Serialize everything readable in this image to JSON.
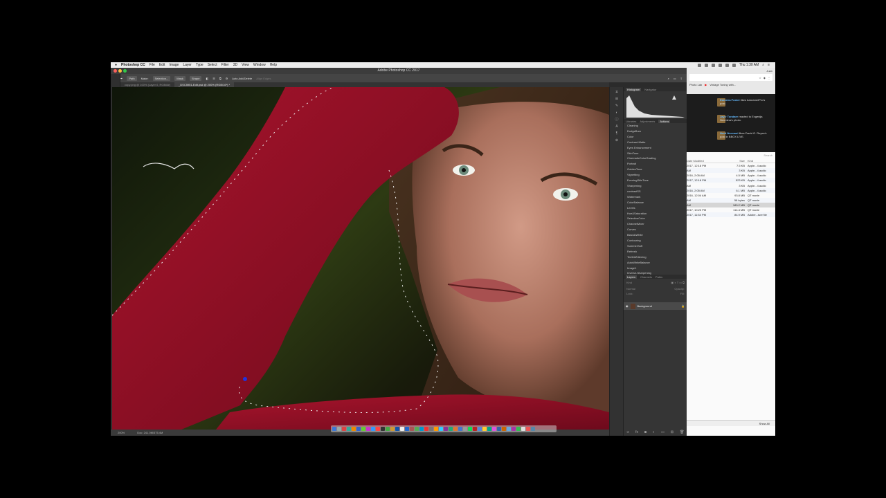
{
  "menubar": {
    "apple": "",
    "app": "Photoshop CC",
    "items": [
      "File",
      "Edit",
      "Image",
      "Layer",
      "Type",
      "Select",
      "Filter",
      "3D",
      "View",
      "Window",
      "Help"
    ],
    "clock": "Thu 1:30 AM"
  },
  "window": {
    "title": "Adobe Photoshop CC 2017"
  },
  "options": {
    "mode": "Path",
    "make": "Make:",
    "selection": "Selection...",
    "mask": "Mask",
    "shape": "Shape",
    "auto": "Auto Add/Delete",
    "align": "Align Edges"
  },
  "tabs": [
    "copy.png @ 100% (Layer 0, RGB/8#)",
    "_DSC5951-Edit.psd @ 200% (RGB/16*) *"
  ],
  "status": {
    "zoom": "200%",
    "doc": "Doc: 241.0M/375.4M"
  },
  "panels": {
    "top_tabs": [
      "Histogram",
      "Navigator"
    ],
    "mid_tabs": [
      "Libraries",
      "Adjustments",
      "Actions"
    ],
    "actions": [
      "Cleaning",
      "DodgeBurn",
      "Color",
      "Contrast-Matte",
      "Eyes Enhancement",
      "SkinTone",
      "CinematicColorGrading",
      "Portrait",
      "GoldenTone",
      "Vignetting",
      "EveningSkinTone",
      "Sharpening",
      "contrastSS",
      "Watermark",
      "ColorBalance",
      "Levels",
      "Hue&Saturation",
      "SelectiveColor",
      "ChannelMixer",
      "Curves",
      "Black&White",
      "Contouring",
      "SummerSoft",
      "Refresh",
      "TeethWhitening",
      "AutoWhiteBalance",
      "Image1",
      "Inverse-Sharpening"
    ],
    "layer_tabs": [
      "Layers",
      "Channels",
      "Paths"
    ],
    "layer_kind": "Kind",
    "layer_blend": "Normal",
    "opacity": "Opacity:",
    "lock": "Lock:",
    "fill": "Fill:",
    "layer_name": "Background"
  },
  "browser": {
    "user": "Juan",
    "bookmarks": [
      "Photo Lab",
      "Vintage Toning with..."
    ]
  },
  "notifications": [
    {
      "name": "Edmena Foster",
      "text": "likes AdorametPro's post."
    },
    {
      "name": "Jay-r Tondare",
      "text": "reacted to Evgenija Neumina's photo."
    },
    {
      "name": "Nord Nermani",
      "text": "likes David G. Reyes's post in BBOX LIVE."
    }
  ],
  "finder": {
    "headers": [
      "Date Modified",
      "Size",
      "Kind"
    ],
    "search": "Search",
    "rows": [
      [
        "2017, 12:18 PM",
        "7.5 KB",
        "Apple...4 audio"
      ],
      [
        "AM",
        "3 KB",
        "Apple...4 audio"
      ],
      [
        "2016, 2:05 AM",
        "4.5 MB",
        "Apple...4 audio"
      ],
      [
        "2017, 12:18 PM",
        "523 KB",
        "Apple...4 audio"
      ],
      [
        "AM",
        "3 KB",
        "Apple...4 audio"
      ],
      [
        "2016, 2:05 AM",
        "6.1 MB",
        "Apple...4 audio"
      ],
      [
        "2016, 12:04 AM",
        "93.8 MB",
        "QT movie"
      ],
      [
        "AM",
        "58 bytes",
        "QT movie"
      ],
      [
        "AM",
        "180.2 MB",
        "QT movie"
      ],
      [
        "2017, 10:23 PM",
        "114.4 MB",
        "QT movie"
      ],
      [
        "2017, 11:54 PM",
        "84.9 MB",
        "Adobe...ture file"
      ]
    ],
    "show_all": "Show All"
  }
}
